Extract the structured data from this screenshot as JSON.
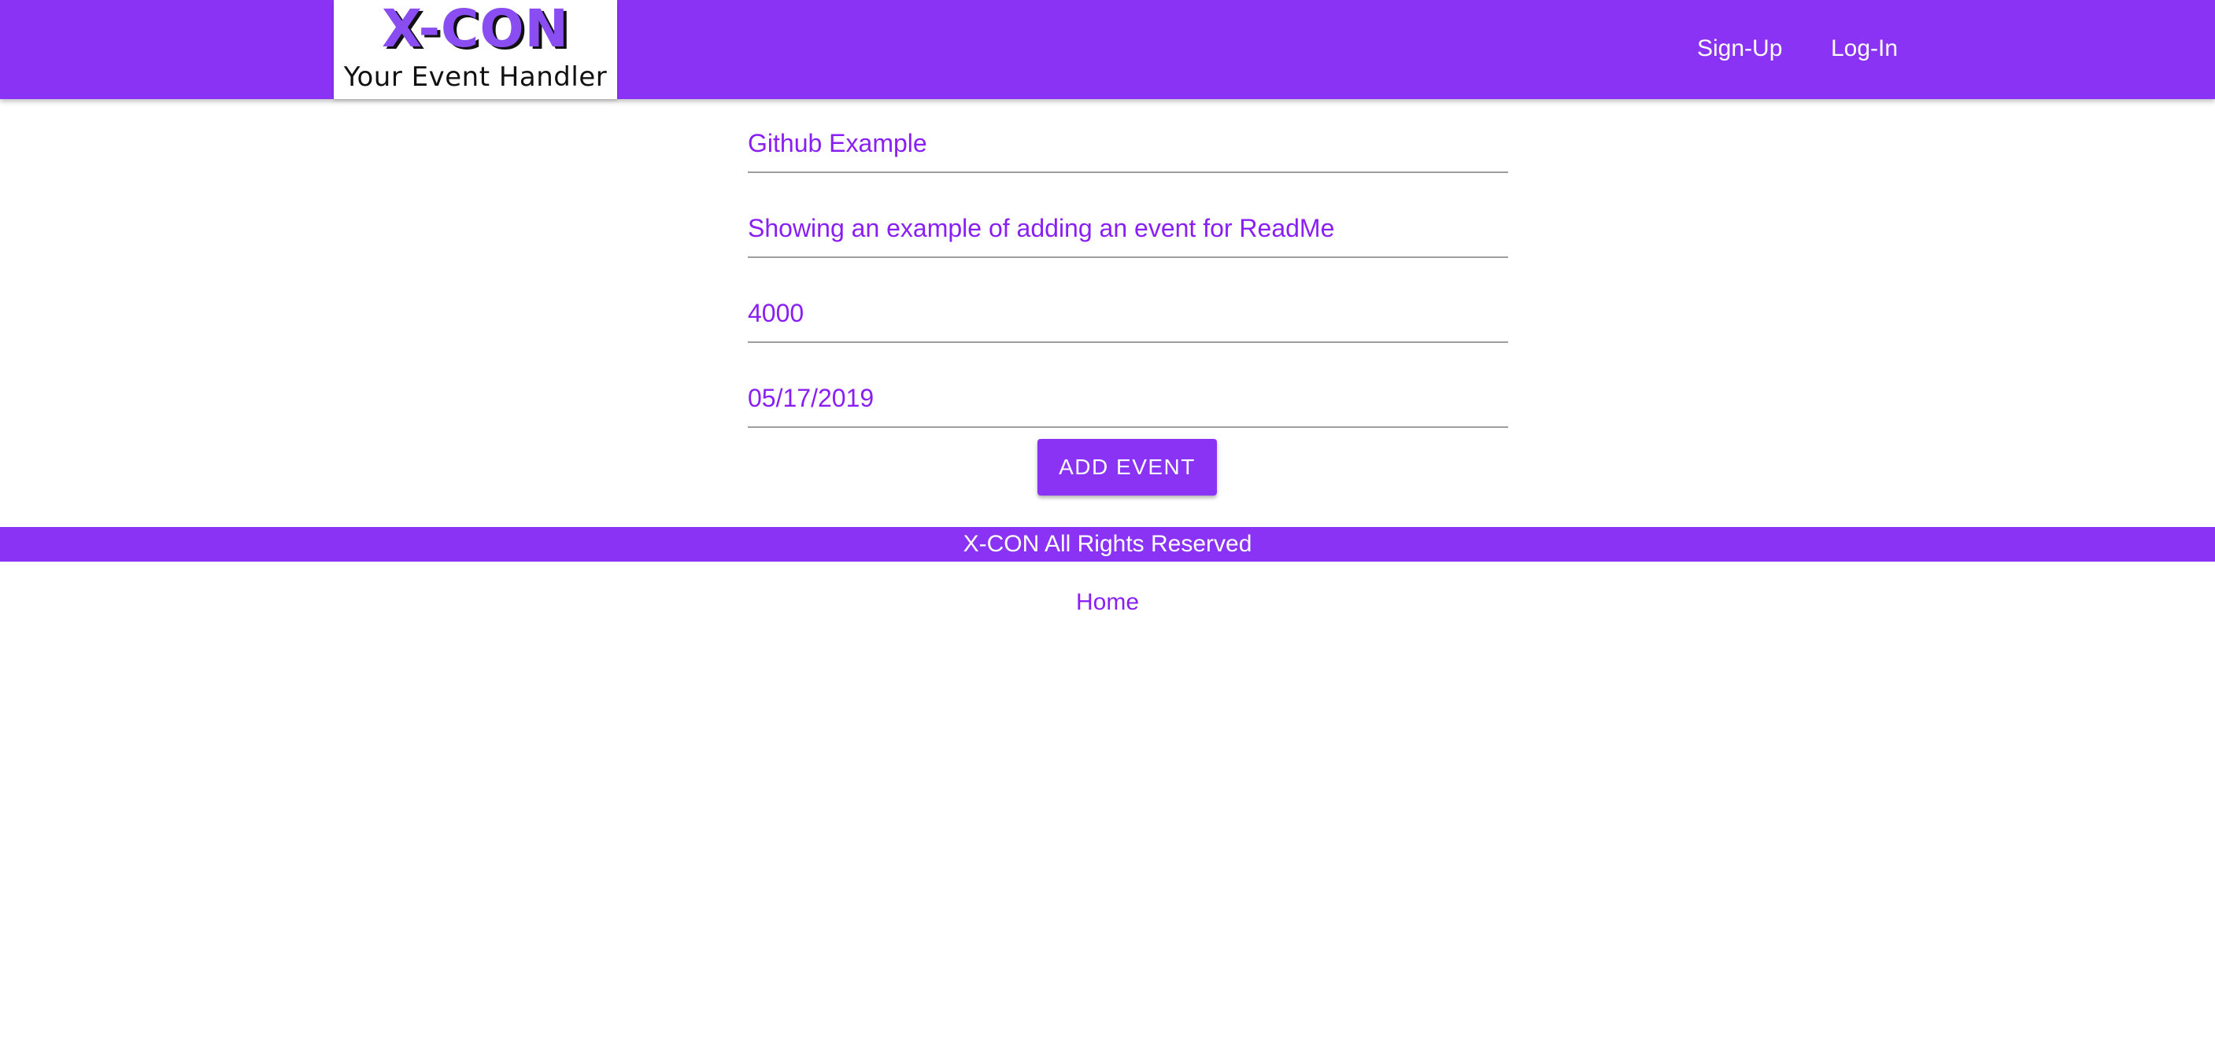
{
  "brand": {
    "title": "X-CON",
    "subtitle": "Your Event Handler"
  },
  "nav": {
    "signup_label": "Sign-Up",
    "login_label": "Log-In"
  },
  "form": {
    "fields": [
      {
        "value": "Github Example"
      },
      {
        "value": "Showing an example of adding an event for ReadMe"
      },
      {
        "value": "4000"
      },
      {
        "value": "05/17/2019"
      }
    ],
    "submit_label": "ADD EVENT"
  },
  "footer": {
    "text": "X-CON All Rights Reserved",
    "home_label": "Home"
  },
  "colors": {
    "brand_purple": "#8a33f5",
    "text_purple": "#8a1ff5",
    "white": "#ffffff"
  }
}
